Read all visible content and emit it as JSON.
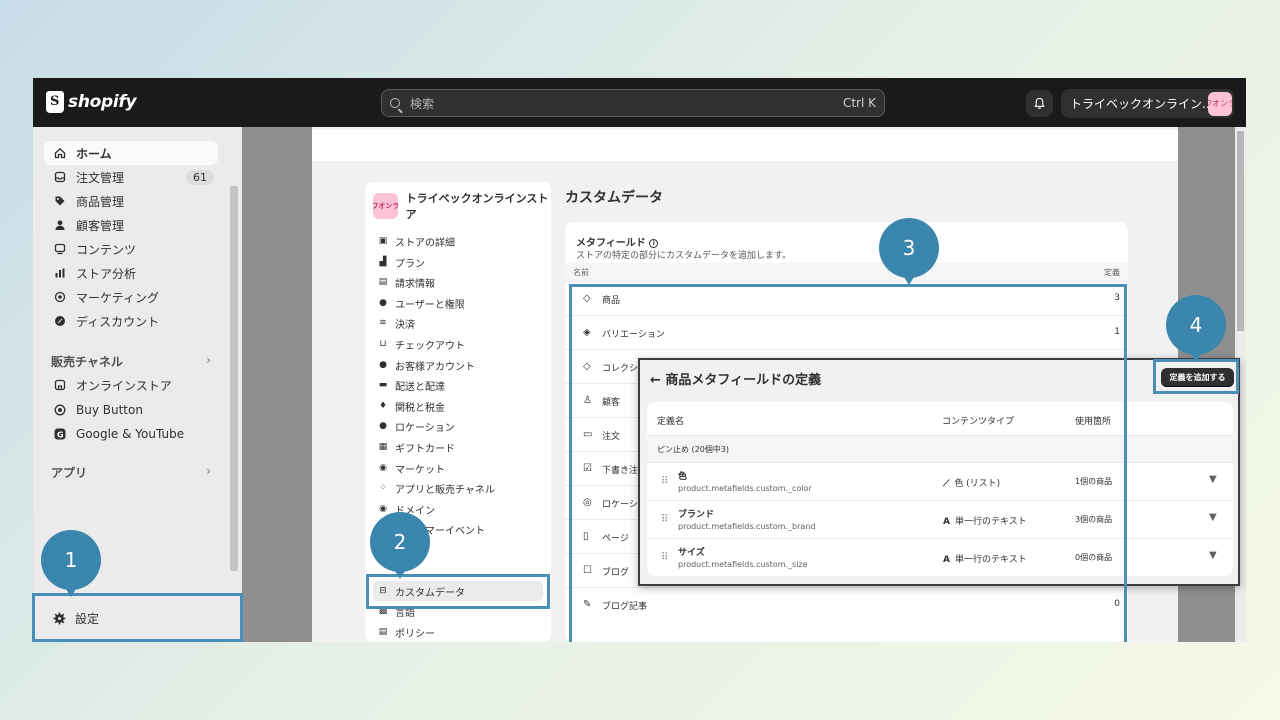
{
  "topbar": {
    "logo_text": "shopify",
    "search_placeholder": "検索",
    "search_shortcut": "Ctrl K",
    "store_name": "トライベックオンライン...",
    "store_avatar": "ワオンラ"
  },
  "sidebar": {
    "items": [
      {
        "label": "ホーム",
        "icon": "home-icon"
      },
      {
        "label": "注文管理",
        "icon": "inbox-icon",
        "badge": "61"
      },
      {
        "label": "商品管理",
        "icon": "tag-icon"
      },
      {
        "label": "顧客管理",
        "icon": "person-icon"
      },
      {
        "label": "コンテンツ",
        "icon": "content-icon"
      },
      {
        "label": "ストア分析",
        "icon": "bar-chart-icon"
      },
      {
        "label": "マーケティング",
        "icon": "target-icon"
      },
      {
        "label": "ディスカウント",
        "icon": "discount-icon"
      }
    ],
    "sales_channels_heading": "販売チャネル",
    "channels": [
      {
        "label": "オンラインストア",
        "icon": "store-icon"
      },
      {
        "label": "Buy Button",
        "icon": "buy-button-icon"
      },
      {
        "label": "Google & YouTube",
        "icon": "google-icon"
      }
    ],
    "apps_heading": "アプリ",
    "settings_label": "設定"
  },
  "settings_nav": {
    "store_name": "トライベックオンラインストア",
    "store_avatar": "ワオンラ",
    "items": [
      {
        "label": "ストアの詳細",
        "icon": "store-icon"
      },
      {
        "label": "プラン",
        "icon": "plan-icon"
      },
      {
        "label": "請求情報",
        "icon": "billing-icon"
      },
      {
        "label": "ユーザーと権限",
        "icon": "users-icon"
      },
      {
        "label": "決済",
        "icon": "payment-icon"
      },
      {
        "label": "チェックアウト",
        "icon": "cart-icon"
      },
      {
        "label": "お客様アカウント",
        "icon": "person-icon"
      },
      {
        "label": "配送と配達",
        "icon": "truck-icon"
      },
      {
        "label": "関税と税金",
        "icon": "tax-icon"
      },
      {
        "label": "ロケーション",
        "icon": "location-icon"
      },
      {
        "label": "ギフトカード",
        "icon": "gift-card-icon"
      },
      {
        "label": "マーケット",
        "icon": "globe-icon"
      },
      {
        "label": "アプリと販売チャネル",
        "icon": "apps-icon"
      },
      {
        "label": "ドメイン",
        "icon": "domain-icon"
      },
      {
        "label": "カスタマーイベント",
        "icon": "events-icon"
      },
      {
        "label": "通知",
        "icon": "bell-icon"
      },
      {
        "label": "カスタムデータ",
        "icon": "custom-data-icon"
      },
      {
        "label": "言語",
        "icon": "language-icon"
      },
      {
        "label": "ポリシー",
        "icon": "policy-icon"
      }
    ]
  },
  "content": {
    "title": "カスタムデータ",
    "metafields_title": "メタフィールド",
    "metafields_desc": "ストアの特定の部分にカスタムデータを追加します。",
    "col_name": "名前",
    "col_def": "定義",
    "rows": [
      {
        "label": "商品",
        "count": "3",
        "icon": "tag-icon"
      },
      {
        "label": "バリエーション",
        "count": "1",
        "icon": "variant-icon"
      },
      {
        "label": "コレクション",
        "count": "",
        "icon": "collection-icon"
      },
      {
        "label": "顧客",
        "count": "",
        "icon": "person-icon"
      },
      {
        "label": "注文",
        "count": "",
        "icon": "order-icon"
      },
      {
        "label": "下書き注文",
        "count": "",
        "icon": "draft-icon"
      },
      {
        "label": "ロケーション",
        "count": "",
        "icon": "location-icon"
      },
      {
        "label": "ページ",
        "count": "",
        "icon": "page-icon"
      },
      {
        "label": "ブログ",
        "count": "",
        "icon": "blog-icon"
      },
      {
        "label": "ブログ記事",
        "count": "0",
        "icon": "pen-icon"
      }
    ]
  },
  "overlay": {
    "title": "商品メタフィールドの定義",
    "add_button": "定義を追加する",
    "col_name": "定義名",
    "col_type": "コンテンツタイプ",
    "col_usage": "使用箇所",
    "pinned_label": "ピン止め (20個中3)",
    "rows": [
      {
        "name": "色",
        "key": "product.metafields.custom._color",
        "type": "色 (リスト)",
        "type_icon": "color-picker-icon",
        "usage": "1個の商品"
      },
      {
        "name": "ブランド",
        "key": "product.metafields.custom._brand",
        "type": "単一行のテキスト",
        "type_icon": "text-icon",
        "usage": "3個の商品"
      },
      {
        "name": "サイズ",
        "key": "product.metafields.custom._size",
        "type": "単一行のテキスト",
        "type_icon": "text-icon",
        "usage": "0個の商品"
      }
    ]
  },
  "callouts": [
    "1",
    "2",
    "3",
    "4"
  ],
  "colors": {
    "accent": "#3a86ad",
    "highlight": "#4a8fb8",
    "topbar": "#1a1a1a"
  }
}
